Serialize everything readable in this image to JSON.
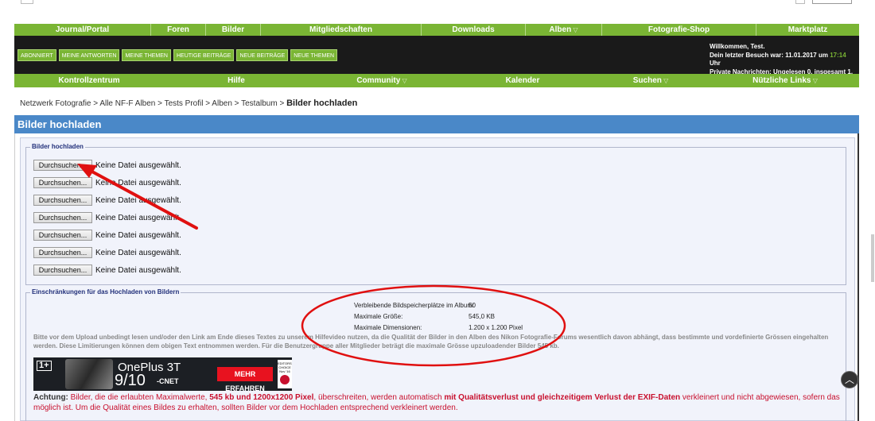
{
  "nav_top": [
    {
      "label": "Journal/Portal",
      "chevron": false
    },
    {
      "label": "Foren",
      "chevron": false
    },
    {
      "label": "Bilder",
      "chevron": false
    },
    {
      "label": "Mitgliedschaften",
      "chevron": false
    },
    {
      "label": "Downloads",
      "chevron": false
    },
    {
      "label": "Alben",
      "chevron": true
    },
    {
      "label": "Fotografie-Shop",
      "chevron": false
    },
    {
      "label": "Marktplatz",
      "chevron": false
    }
  ],
  "quick_buttons": [
    "ABONNIERT",
    "MEINE ANTWORTEN",
    "MEINE THEMEN",
    "HEUTIGE BEITRÄGE",
    "NEUE BEITRÄGE",
    "NEUE THEMEN"
  ],
  "welcome": {
    "line1": "Willkommen, Test.",
    "line2_prefix": "Dein letzter Besuch war: 11.01.2017 um",
    "line2_time": "17:14",
    "line2_suffix": "Uhr",
    "line3": "Private Nachrichten: Ungelesen 0, insgesamt 1."
  },
  "nav_second": [
    {
      "label": "Kontrollzentrum",
      "chevron": false
    },
    {
      "label": "Hilfe",
      "chevron": false
    },
    {
      "label": "Community",
      "chevron": true
    },
    {
      "label": "Kalender",
      "chevron": false
    },
    {
      "label": "Suchen",
      "chevron": true
    },
    {
      "label": "Nützliche Links",
      "chevron": true
    }
  ],
  "breadcrumb": {
    "path": "Netzwerk Fotografie > Alle NF-F Alben > Tests Profil > Alben > Testalbum >",
    "current": "Bilder hochladen"
  },
  "page_title": "Bilder hochladen",
  "upload": {
    "legend": "Bilder hochladen",
    "rows": [
      {
        "button": "Durchsuchen...",
        "status": "Keine Datei ausgewählt."
      },
      {
        "button": "Durchsuchen...",
        "status": "Keine Datei ausgewählt."
      },
      {
        "button": "Durchsuchen...",
        "status": "Keine Datei ausgewählt."
      },
      {
        "button": "Durchsuchen...",
        "status": "Keine Datei ausgewählt."
      },
      {
        "button": "Durchsuchen...",
        "status": "Keine Datei ausgewählt."
      },
      {
        "button": "Durchsuchen...",
        "status": "Keine Datei ausgewählt."
      },
      {
        "button": "Durchsuchen...",
        "status": "Keine Datei ausgewählt."
      }
    ]
  },
  "restrictions": {
    "legend": "Einschränkungen für das Hochladen von Bildern",
    "rows": [
      {
        "label": "Verbleibende Bildspeicherplätze im Album:",
        "value": "50"
      },
      {
        "label": "Maximale Größe:",
        "value": "545,0 KB"
      },
      {
        "label": "Maximale Dimensionen:",
        "value": "1.200 x 1.200 Pixel"
      }
    ],
    "info": "Bitte vor dem Upload unbedingt lesen und/oder den Link am Ende dieses Textes zu unserem Hilfevideo nutzen, da die Qualität der Bilder in den Alben des Nikon Fotografie-Forums wesentlich davon abhängt, dass bestimmte und vordefinierte Grössen eingehalten werden. Diese Limitierungen können dem obigen Text entnommen werden. Für die Benutzergruppe aller Mitglieder beträgt die maximale Grösse upzuloadender Bilder 545 kb."
  },
  "ad": {
    "logo": "1+",
    "model": "OnePlus 3T",
    "score": "9/10",
    "source": "-CNET",
    "cta": "MEHR ERFAHREN",
    "badge_text": "EDITORS' CHOICE Nov '16"
  },
  "warning": {
    "lead": "Achtung:",
    "p1": " Bilder, die die erlaubten Maximalwerte, ",
    "b1": "545 kb und 1200x1200 Pixel",
    "p2": ", überschreiten, werden automatisch ",
    "b2": "mit Qualitätsverlust und gleichzeitigem Verlust der EXIF-Daten",
    "p3": " verkleinert und nicht abgewiesen, sofern das möglich ist. Um die Qualität eines Bildes zu erhalten, sollten Bilder vor dem Hochladen entsprechend verkleinert werden."
  },
  "colors": {
    "green": "#7ab534",
    "black_bar": "#1a1a1a",
    "title_blue": "#4a88c8",
    "annotation_red": "#e01010",
    "warning_red": "#c8102e"
  },
  "icons": {
    "scroll_top": "chevron-up-icon",
    "dropdown": "chevron-down-icon"
  }
}
